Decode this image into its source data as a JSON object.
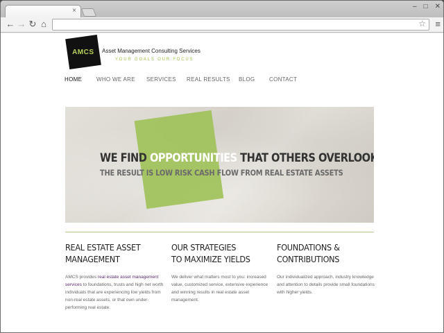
{
  "browser": {
    "tab_close": "×",
    "minimize": "–",
    "maximize": "□",
    "close": "✕",
    "back": "←",
    "forward": "→",
    "reload": "↻",
    "home": "⌂",
    "star": "☆",
    "menu": "≡",
    "url": ""
  },
  "site": {
    "logo_text": "AMCS",
    "company_name": "Asset Management Consulting Services",
    "tagline": "YOUR GOALS  OUR FOCUS",
    "accent_color": "#9fc25a"
  },
  "nav": {
    "items": [
      {
        "label": "HOME"
      },
      {
        "label": "WHO WE ARE"
      },
      {
        "label": "SERVICES"
      },
      {
        "label": "REAL RESULTS"
      },
      {
        "label": "BLOG"
      },
      {
        "label": "CONTACT"
      }
    ]
  },
  "hero": {
    "headline_pre": "WE FIND ",
    "headline_highlight": "OPPORTUNITIES",
    "headline_post": " THAT OTHERS OVERLOOK.",
    "subline": "THE RESULT IS LOW RISK CASH FLOW FROM REAL ESTATE ASSETS"
  },
  "columns": [
    {
      "title_line1": "REAL ESTATE ASSET",
      "title_line2": "MANAGEMENT",
      "text_pre": "AMCS provides ",
      "text_link": "real estate asset management services",
      "text_post": " to foundations, trusts and high net worth individuals that are experiencing low yields from non-real estate assets, or that own under-performing real estate."
    },
    {
      "title_line1": "OUR STRATEGIES",
      "title_line2": "TO MAXIMIZE YIELDS",
      "text": "We deliver what matters most to you: increased value, customized service, extensive experience and winning results in real estate asset management."
    },
    {
      "title_line1": "FOUNDATIONS &",
      "title_line2": "CONTRIBUTIONS",
      "text": "Our individualized approach, industry knowledge and attention to details provide small foundations with higher yields."
    }
  ]
}
